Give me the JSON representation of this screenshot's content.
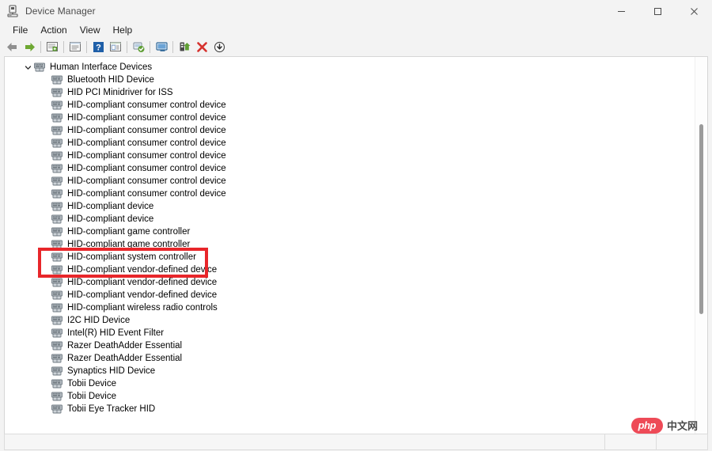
{
  "window": {
    "title": "Device Manager",
    "title_icon": "device-manager-icon",
    "minimize": "—",
    "maximize": "□",
    "close": "✕"
  },
  "menubar": {
    "items": [
      {
        "label": "File"
      },
      {
        "label": "Action"
      },
      {
        "label": "View"
      },
      {
        "label": "Help"
      }
    ]
  },
  "toolbar": {
    "buttons": [
      {
        "name": "back-icon",
        "tooltip": "Back"
      },
      {
        "name": "forward-icon",
        "tooltip": "Forward"
      },
      {
        "sep": true
      },
      {
        "name": "show-hidden-devices-icon",
        "tooltip": "Show hidden devices"
      },
      {
        "sep": true
      },
      {
        "name": "properties-icon",
        "tooltip": "Properties"
      },
      {
        "sep": true
      },
      {
        "name": "help-icon",
        "tooltip": "Help"
      },
      {
        "name": "view-list-icon",
        "tooltip": "View"
      },
      {
        "sep": true
      },
      {
        "name": "scan-hardware-changes-icon",
        "tooltip": "Scan for hardware changes"
      },
      {
        "sep": true
      },
      {
        "name": "computer-icon",
        "tooltip": "Computer"
      },
      {
        "sep": true
      },
      {
        "name": "update-driver-icon",
        "tooltip": "Update driver"
      },
      {
        "name": "uninstall-device-icon",
        "tooltip": "Uninstall device"
      },
      {
        "name": "disable-device-icon",
        "tooltip": "Disable device"
      }
    ]
  },
  "tree": {
    "root": {
      "label": "Human Interface Devices",
      "expanded": true,
      "icon": "hid-device-icon"
    },
    "children": [
      {
        "label": "Bluetooth HID Device",
        "icon": "hid-device-icon",
        "highlighted": false
      },
      {
        "label": "HID PCI Minidriver for ISS",
        "icon": "hid-device-icon",
        "highlighted": false
      },
      {
        "label": "HID-compliant consumer control device",
        "icon": "hid-device-icon",
        "highlighted": false
      },
      {
        "label": "HID-compliant consumer control device",
        "icon": "hid-device-icon",
        "highlighted": false
      },
      {
        "label": "HID-compliant consumer control device",
        "icon": "hid-device-icon",
        "highlighted": false
      },
      {
        "label": "HID-compliant consumer control device",
        "icon": "hid-device-icon",
        "highlighted": false
      },
      {
        "label": "HID-compliant consumer control device",
        "icon": "hid-device-icon",
        "highlighted": false
      },
      {
        "label": "HID-compliant consumer control device",
        "icon": "hid-device-icon",
        "highlighted": false
      },
      {
        "label": "HID-compliant consumer control device",
        "icon": "hid-device-icon",
        "highlighted": false
      },
      {
        "label": "HID-compliant consumer control device",
        "icon": "hid-device-icon",
        "highlighted": false
      },
      {
        "label": "HID-compliant device",
        "icon": "hid-device-icon",
        "highlighted": false
      },
      {
        "label": "HID-compliant device",
        "icon": "hid-device-icon",
        "highlighted": false
      },
      {
        "label": "HID-compliant game controller",
        "icon": "hid-device-icon",
        "highlighted": true
      },
      {
        "label": "HID-compliant game controller",
        "icon": "hid-device-icon",
        "highlighted": true
      },
      {
        "label": "HID-compliant system controller",
        "icon": "hid-device-icon",
        "highlighted": false
      },
      {
        "label": "HID-compliant vendor-defined device",
        "icon": "hid-device-icon",
        "highlighted": false
      },
      {
        "label": "HID-compliant vendor-defined device",
        "icon": "hid-device-icon",
        "highlighted": false
      },
      {
        "label": "HID-compliant vendor-defined device",
        "icon": "hid-device-icon",
        "highlighted": false
      },
      {
        "label": "HID-compliant wireless radio controls",
        "icon": "hid-device-icon",
        "highlighted": false
      },
      {
        "label": "I2C HID Device",
        "icon": "hid-device-icon",
        "highlighted": false
      },
      {
        "label": "Intel(R) HID Event Filter",
        "icon": "hid-device-icon",
        "highlighted": false
      },
      {
        "label": "Razer DeathAdder Essential",
        "icon": "hid-device-icon",
        "highlighted": false
      },
      {
        "label": "Razer DeathAdder Essential",
        "icon": "hid-device-icon",
        "highlighted": false
      },
      {
        "label": "Synaptics HID Device",
        "icon": "hid-device-icon",
        "highlighted": false
      },
      {
        "label": "Tobii Device",
        "icon": "hid-device-icon",
        "highlighted": false
      },
      {
        "label": "Tobii Device",
        "icon": "hid-device-icon",
        "highlighted": false
      },
      {
        "label": "Tobii Eye Tracker HID",
        "icon": "hid-device-icon",
        "highlighted": false
      }
    ]
  },
  "annotation": {
    "type": "red-rectangle-highlight",
    "color": "#e8262a",
    "targets": [
      "HID-compliant game controller",
      "HID-compliant game controller"
    ]
  },
  "watermark": {
    "badge": "php",
    "text": "中文网"
  },
  "colors": {
    "window_bg": "#f3f3f3",
    "content_bg": "#ffffff",
    "text": "#000000",
    "title_text": "#4a4a4a",
    "accent_red": "#e8262a",
    "scrollbar_thumb": "#9b9b9b"
  }
}
